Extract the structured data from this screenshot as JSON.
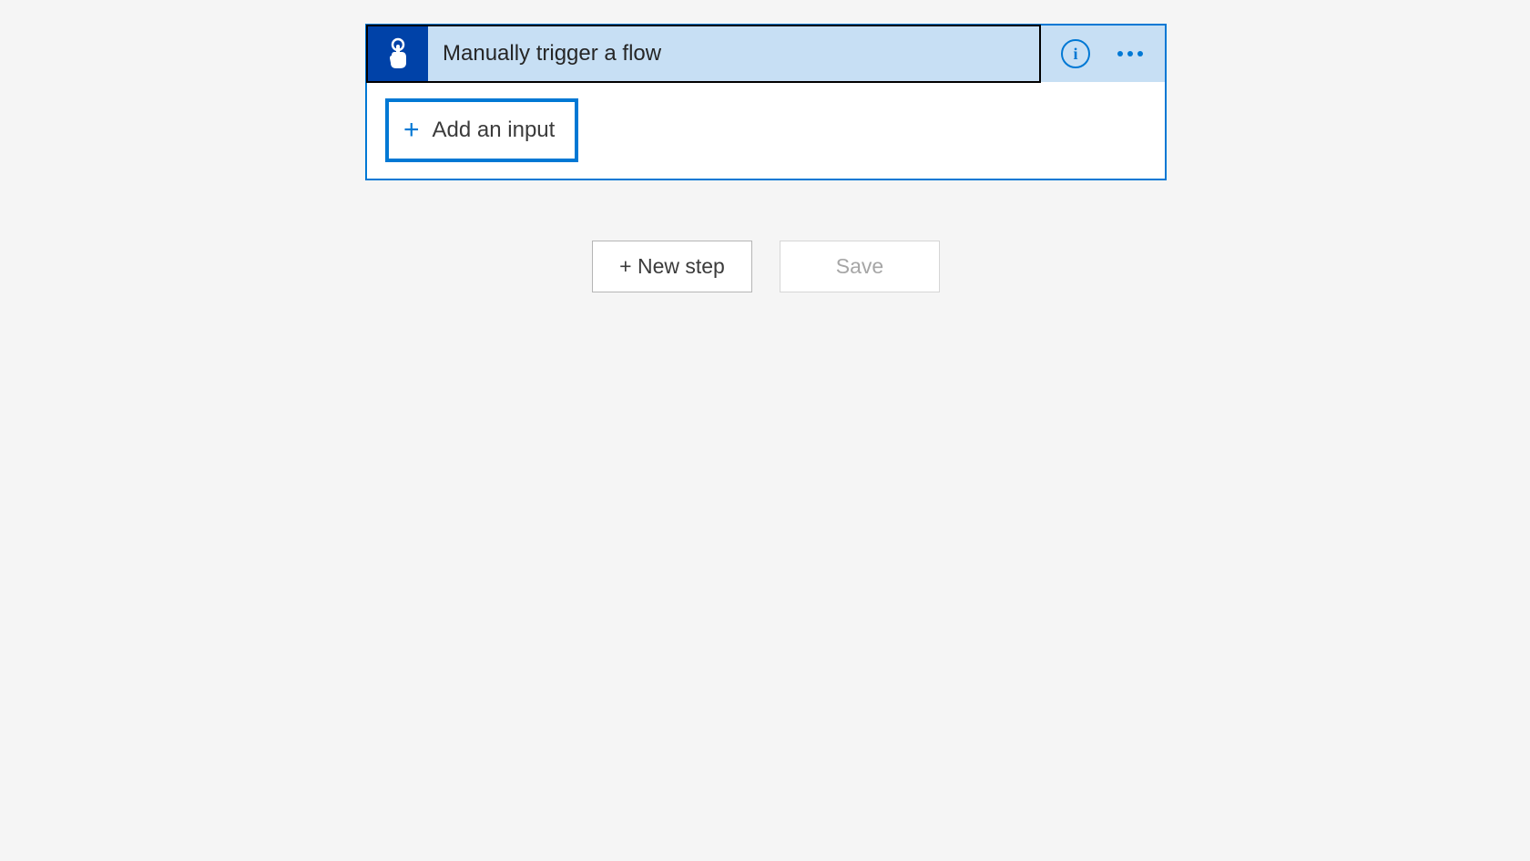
{
  "trigger": {
    "title": "Manually trigger a flow",
    "add_input_label": "Add an input"
  },
  "actions": {
    "new_step": "+ New step",
    "save": "Save"
  },
  "icons": {
    "info": "i"
  }
}
